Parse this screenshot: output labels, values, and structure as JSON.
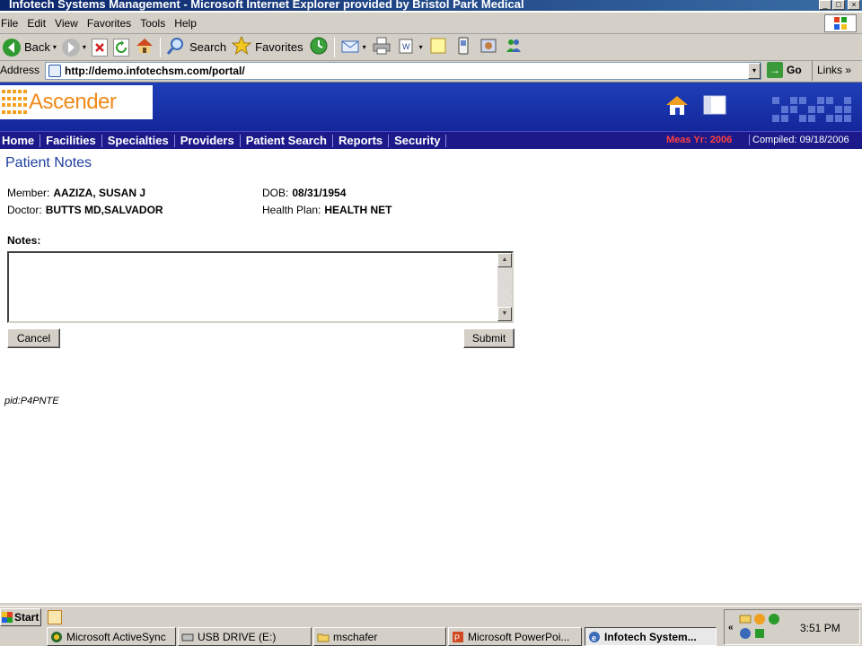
{
  "window": {
    "title": "Infotech Systems Management - Microsoft Internet Explorer provided by Bristol Park Medical",
    "min": "_",
    "max": "□",
    "close": "×"
  },
  "menu": [
    "File",
    "Edit",
    "View",
    "Favorites",
    "Tools",
    "Help"
  ],
  "toolbar": {
    "back_label": "Back",
    "search_label": "Search",
    "favorites_label": "Favorites",
    "drop": "▾"
  },
  "address": {
    "label": "Address",
    "url": "http://demo.infotechsm.com/portal/",
    "go_label": "Go",
    "links_label": "Links",
    "drop": "▾",
    "go_arrow": "→",
    "links_arrow": "»"
  },
  "app": {
    "logo_text": "Ascender",
    "nav": [
      "Home",
      "Facilities",
      "Specialties",
      "Providers",
      "Patient Search",
      "Reports",
      "Security"
    ],
    "meas_yr": "Meas Yr: 2006",
    "compiled": "Compiled: 09/18/2006"
  },
  "page": {
    "title": "Patient Notes",
    "member_label": "Member:",
    "member_value": "AAZIZA, SUSAN J",
    "doctor_label": "Doctor:",
    "doctor_value": "BUTTS MD,SALVADOR",
    "dob_label": "DOB:",
    "dob_value": "08/31/1954",
    "plan_label": "Health Plan:",
    "plan_value": "HEALTH NET",
    "notes_label": "Notes:",
    "notes_value": "",
    "cancel_label": "Cancel",
    "submit_label": "Submit",
    "pid": "pid:P4PNTE",
    "scroll_up": "▲",
    "scroll_down": "▼"
  },
  "taskbar": {
    "start_label": "Start",
    "tasks": [
      "Microsoft ActiveSync",
      "USB DRIVE (E:)",
      "mschafer",
      "Microsoft PowerPoi...",
      "Infotech System..."
    ],
    "tray_chevron": "«",
    "clock": "3:51 PM"
  },
  "colors": {
    "title_bar": "#0a246a",
    "nav_bar": "#1c1a8a",
    "header": "#1f3fb8",
    "logo_orange": "#f08a1a",
    "page_title": "#1f3f9e",
    "meas_red": "#ff4040"
  },
  "icons": [
    "back-arrow-icon",
    "forward-arrow-icon",
    "stop-icon",
    "refresh-icon",
    "home-icon",
    "search-icon",
    "favorites-star-icon",
    "history-icon",
    "mail-icon",
    "print-icon",
    "edit-icon",
    "discuss-icon",
    "messenger-icon",
    "research-icon",
    "windows-logo-icon",
    "page-icon",
    "go-arrow-icon",
    "house-icon",
    "window-icon"
  ]
}
